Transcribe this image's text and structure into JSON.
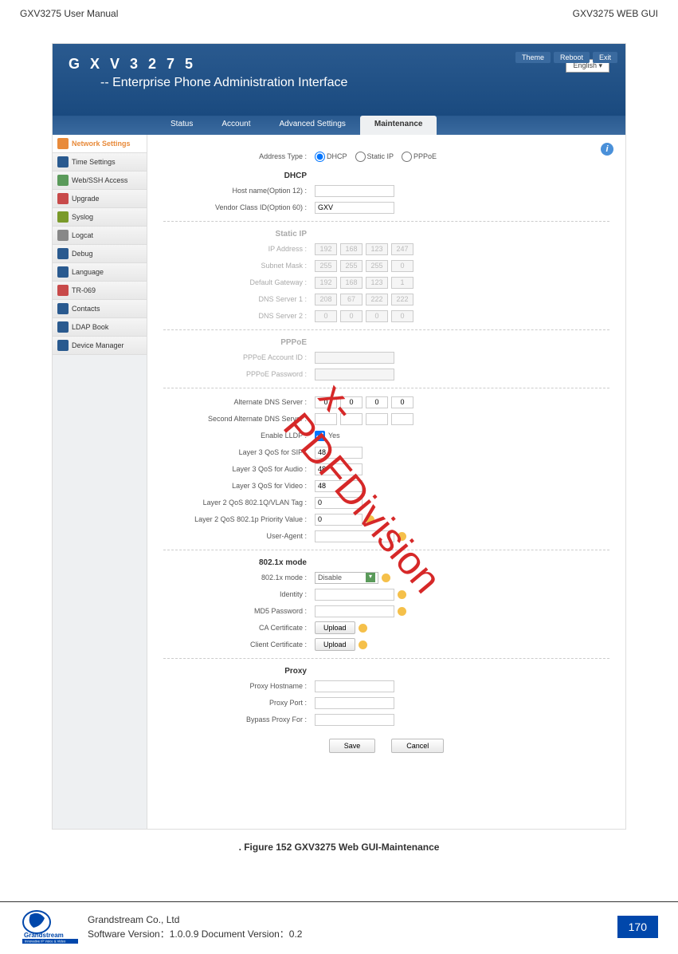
{
  "page_header": {
    "left": "GXV3275 User Manual",
    "right": "GXV3275 WEB GUI"
  },
  "gui_header": {
    "title": "G X V 3 2 7 5",
    "subtitle": "-- Enterprise Phone Administration Interface"
  },
  "gui_tools": {
    "theme": "Theme",
    "reboot": "Reboot",
    "exit": "Exit",
    "lang": "English"
  },
  "nav_tabs": [
    "Status",
    "Account",
    "Advanced Settings",
    "Maintenance"
  ],
  "sidebar": {
    "items": [
      {
        "label": "Network Settings",
        "active": true,
        "color": "#e88a3a"
      },
      {
        "label": "Time Settings",
        "color": "#2a5a8f"
      },
      {
        "label": "Web/SSH Access",
        "color": "#5a9a5a"
      },
      {
        "label": "Upgrade",
        "color": "#c84a4a"
      },
      {
        "label": "Syslog",
        "color": "#7a9a2a"
      },
      {
        "label": "Logcat",
        "color": "#888"
      },
      {
        "label": "Debug",
        "color": "#2a5a8f"
      },
      {
        "label": "Language",
        "color": "#2a5a8f"
      },
      {
        "label": "TR-069",
        "color": "#c84a4a"
      },
      {
        "label": "Contacts",
        "color": "#2a5a8f"
      },
      {
        "label": "LDAP Book",
        "color": "#2a5a8f"
      },
      {
        "label": "Device Manager",
        "color": "#2a5a8f"
      }
    ]
  },
  "form": {
    "address_type": {
      "label": "Address Type :",
      "opts": [
        "DHCP",
        "Static IP",
        "PPPoE"
      ]
    },
    "dhcp_title": "DHCP",
    "hostname": {
      "label": "Host name(Option 12) :",
      "value": ""
    },
    "vendor": {
      "label": "Vendor Class ID(Option 60) :",
      "value": "GXV"
    },
    "static_title": "Static IP",
    "ip": {
      "label": "IP Address :",
      "oct": [
        "192",
        "168",
        "123",
        "247"
      ]
    },
    "subnet": {
      "label": "Subnet Mask :",
      "oct": [
        "255",
        "255",
        "255",
        "0"
      ]
    },
    "gateway": {
      "label": "Default Gateway :",
      "oct": [
        "192",
        "168",
        "123",
        "1"
      ]
    },
    "dns1": {
      "label": "DNS Server 1 :",
      "oct": [
        "208",
        "67",
        "222",
        "222"
      ]
    },
    "dns2": {
      "label": "DNS Server 2 :",
      "oct": [
        "0",
        "0",
        "0",
        "0"
      ]
    },
    "pppoe_title": "PPPoE",
    "pppoe_acc": {
      "label": "PPPoE Account ID :",
      "value": ""
    },
    "pppoe_pw": {
      "label": "PPPoE Password :",
      "value": ""
    },
    "alt_dns": {
      "label": "Alternate DNS Server :",
      "oct": [
        "0",
        "0",
        "0",
        "0"
      ]
    },
    "alt_dns2": {
      "label": "Second Alternate DNS Server :",
      "oct": [
        "",
        "",
        "",
        ""
      ]
    },
    "lldp": {
      "label": "Enable LLDP :",
      "value": "Yes"
    },
    "qos_sip": {
      "label": "Layer 3 QoS for SIP :",
      "value": "48"
    },
    "qos_audio": {
      "label": "Layer 3 QoS for Audio :",
      "value": "48"
    },
    "qos_video": {
      "label": "Layer 3 QoS for Video :",
      "value": "48"
    },
    "vlan_tag": {
      "label": "Layer 2 QoS 802.1Q/VLAN Tag :",
      "value": "0"
    },
    "vlan_pri": {
      "label": "Layer 2 QoS 802.1p Priority Value :",
      "value": "0"
    },
    "user_agent": {
      "label": "User-Agent :",
      "value": ""
    },
    "x802_title": "802.1x mode",
    "x802_mode": {
      "label": "802.1x mode :",
      "value": "Disable"
    },
    "identity": {
      "label": "Identity :",
      "value": ""
    },
    "md5": {
      "label": "MD5 Password :",
      "value": ""
    },
    "ca_cert": {
      "label": "CA Certificate :",
      "btn": "Upload"
    },
    "client_cert": {
      "label": "Client Certificate :",
      "btn": "Upload"
    },
    "proxy_title": "Proxy",
    "proxy_host": {
      "label": "Proxy Hostname :",
      "value": ""
    },
    "proxy_port": {
      "label": "Proxy Port :",
      "value": ""
    },
    "bypass": {
      "label": "Bypass Proxy For :",
      "value": ""
    },
    "save": "Save",
    "cancel": "Cancel"
  },
  "watermark": "x-PDFDivision",
  "figure_caption": ". Figure 152 GXV3275 Web GUI-Maintenance",
  "footer": {
    "company": "Grandstream Co., Ltd",
    "version": "Software Version：1.0.0.9 Document Version：0.2",
    "logo_brand": "Grandstream",
    "logo_tagline": "Innovative IP Voice & Video",
    "page": "170"
  }
}
